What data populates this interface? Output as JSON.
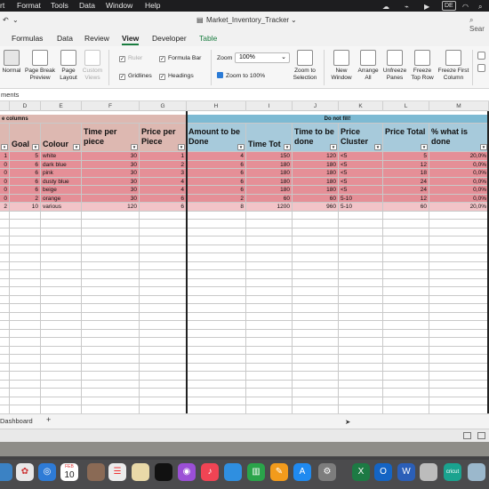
{
  "menubar": {
    "items": [
      "rt",
      "Format",
      "Tools",
      "Data",
      "Window",
      "Help"
    ],
    "lang": "DE"
  },
  "title": {
    "filename": "Market_Inventory_Tracker",
    "search": "Sear"
  },
  "tabs": [
    "Formulas",
    "Data",
    "Review",
    "View",
    "Developer",
    "Table"
  ],
  "ribbon": {
    "normal": "Normal",
    "page_break": "Page Break Preview",
    "page_layout": "Page Layout",
    "custom_views": "Custom Views",
    "ruler": "Ruler",
    "gridlines": "Gridlines",
    "formula_bar": "Formula Bar",
    "headings": "Headings",
    "zoom_label": "Zoom",
    "zoom_value": "100%",
    "zoom_to_100": "Zoom to 100%",
    "zoom_to_selection": "Zoom to Selection",
    "new_window": "New Window",
    "arrange_all": "Arrange All",
    "unfreeze_panes": "Unfreeze Panes",
    "freeze_top_row": "Freeze Top Row",
    "freeze_first_column": "Freeze First Column"
  },
  "namebar": "ments",
  "columns": [
    "D",
    "E",
    "F",
    "G",
    "H",
    "I",
    "J",
    "K",
    "L",
    "M"
  ],
  "group_headers": {
    "left": "e columns",
    "right": "Do not fill!"
  },
  "headers": {
    "goal": "Goal",
    "colour": "Colour",
    "time_per_piece": "Time per piece",
    "price_per_piece": "Price per Piece",
    "amount_to_be_done": "Amount to be Done",
    "time_tot": "Time Tot",
    "time_to_be_done": "Time to be done",
    "price_cluster": "Price Cluster",
    "price_total": "Price Total",
    "pct_done": "% what is done"
  },
  "rows": [
    {
      "c": "1",
      "goal": "5",
      "colour": "white",
      "tpp": "30",
      "ppp": "1",
      "amount": "4",
      "timetot": "150",
      "timedone": "120",
      "cluster": "<5",
      "total": "5",
      "pct": "20,0%"
    },
    {
      "c": "0",
      "goal": "6",
      "colour": "dark blue",
      "tpp": "30",
      "ppp": "2",
      "amount": "6",
      "timetot": "180",
      "timedone": "180",
      "cluster": "<5",
      "total": "12",
      "pct": "0,0%"
    },
    {
      "c": "0",
      "goal": "6",
      "colour": "pink",
      "tpp": "30",
      "ppp": "3",
      "amount": "6",
      "timetot": "180",
      "timedone": "180",
      "cluster": "<5",
      "total": "18",
      "pct": "0,0%"
    },
    {
      "c": "0",
      "goal": "6",
      "colour": "dusty blue",
      "tpp": "30",
      "ppp": "4",
      "amount": "6",
      "timetot": "180",
      "timedone": "180",
      "cluster": "<5",
      "total": "24",
      "pct": "0,0%"
    },
    {
      "c": "0",
      "goal": "6",
      "colour": "beige",
      "tpp": "30",
      "ppp": "4",
      "amount": "6",
      "timetot": "180",
      "timedone": "180",
      "cluster": "<5",
      "total": "24",
      "pct": "0,0%"
    },
    {
      "c": "0",
      "goal": "2",
      "colour": "orange",
      "tpp": "30",
      "ppp": "6",
      "amount": "2",
      "timetot": "60",
      "timedone": "60",
      "cluster": "5-10",
      "total": "12",
      "pct": "0,0%"
    },
    {
      "c": "2",
      "goal": "10",
      "colour": "various",
      "tpp": "120",
      "ppp": "6",
      "amount": "8",
      "timetot": "1200",
      "timedone": "960",
      "cluster": "5-10",
      "total": "60",
      "pct": "20,0%"
    }
  ],
  "sheet_tab": "Dashboard",
  "add_sheet": "+",
  "dock_calendar": {
    "month": "FEB",
    "day": "10"
  },
  "colors": {
    "header_left": "#ddb8b1",
    "header_right": "#a7cadb",
    "row_pink": "#e58f97",
    "row_last": "#f2c4c8",
    "group_right": "#7dbad3"
  }
}
